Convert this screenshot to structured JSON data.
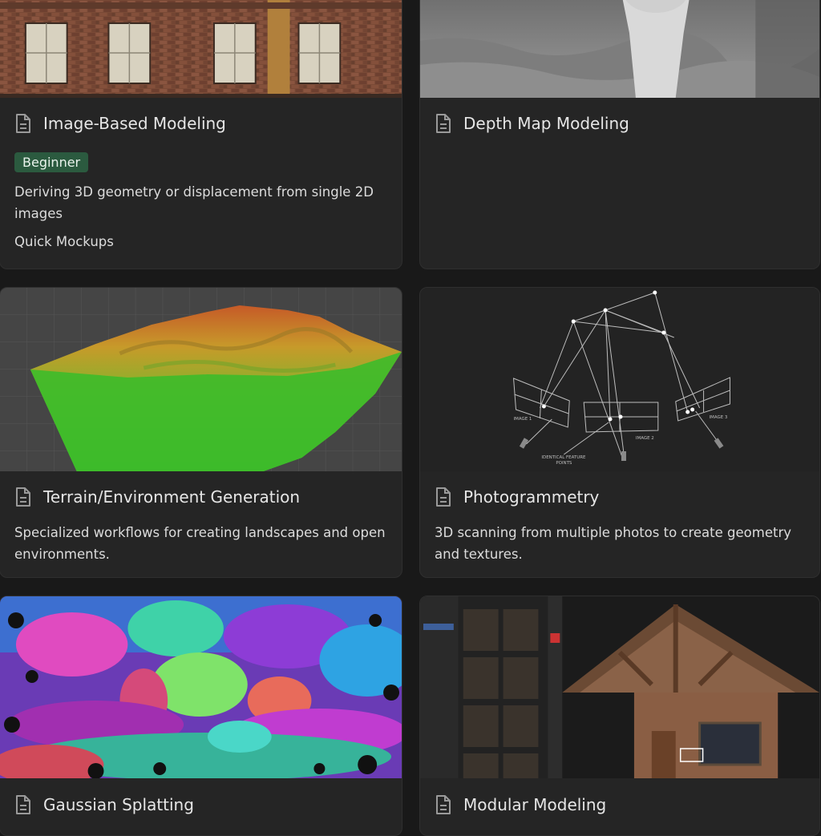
{
  "cards": [
    {
      "title": "Image-Based Modeling",
      "tag": "Beginner",
      "description": "Deriving 3D geometry or displacement from single 2D images",
      "property": "Quick Mockups",
      "icon": "document-icon",
      "cover": "brick-building-facade"
    },
    {
      "title": "Depth Map Modeling",
      "icon": "document-icon",
      "cover": "grayscale-depth-map"
    },
    {
      "title": "Terrain/Environment Generation",
      "description": "Specialized workflows for creating landscapes and open environments.",
      "icon": "document-icon",
      "cover": "heightmap-terrain-mesh"
    },
    {
      "title": "Photogrammetry",
      "description": "3D scanning from multiple photos to create geometry and textures.",
      "icon": "document-icon",
      "cover": "camera-triangulation-diagram",
      "cover_labels": {
        "image1": "IMAGE 1",
        "image2": "IMAGE 2",
        "image3": "IMAGE 3",
        "feature_line1": "IDENTICAL FEATURE",
        "feature_line2": "POINTS"
      }
    },
    {
      "title": "Gaussian Splatting",
      "icon": "document-icon",
      "cover": "colorful-splat-scene"
    },
    {
      "title": "Modular Modeling",
      "icon": "document-icon",
      "cover": "asset-browser-house"
    }
  ],
  "colors": {
    "background": "#191919",
    "card": "#252525",
    "tag_bg": "#2b5a3f",
    "text": "#e3e3e3"
  }
}
